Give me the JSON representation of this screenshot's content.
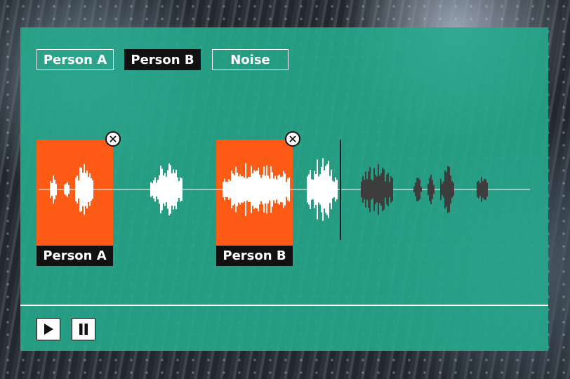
{
  "tabs": [
    {
      "label": "Person A",
      "active": false
    },
    {
      "label": "Person B",
      "active": true
    },
    {
      "label": "Noise",
      "active": false
    }
  ],
  "clips": [
    {
      "label": "Person A"
    },
    {
      "label": "Person B"
    }
  ],
  "controls": {
    "play_icon": "play-icon",
    "pause_icon": "pause-icon"
  },
  "colors": {
    "panel": "#26a88c",
    "clip": "#fe5c16",
    "label_bg": "#111111",
    "wave_played": "#ffffff",
    "wave_unplayed": "#3d3d3d"
  }
}
